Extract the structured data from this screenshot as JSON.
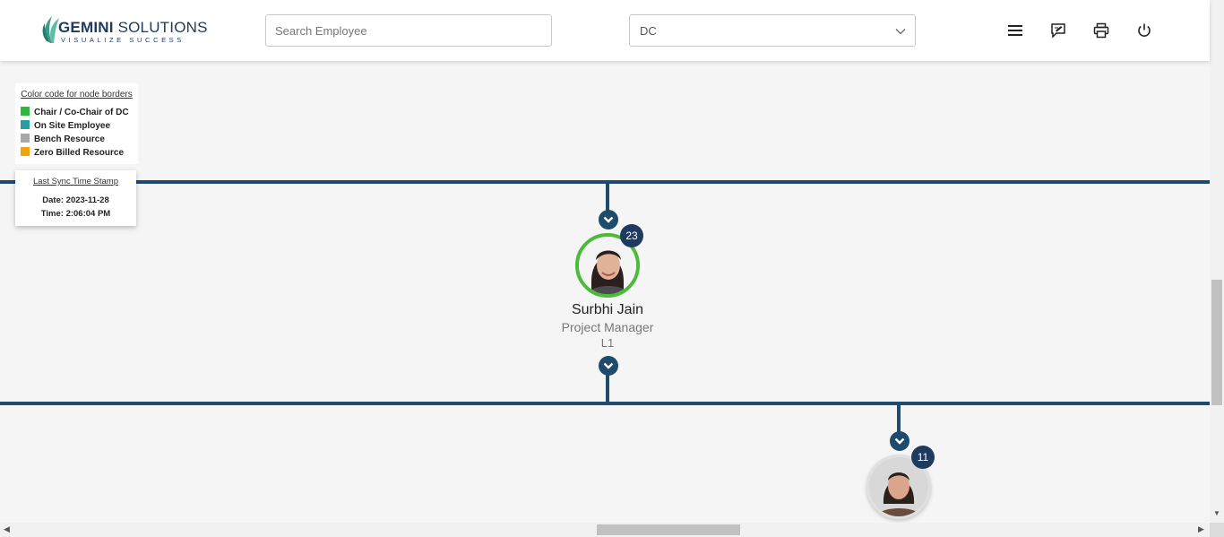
{
  "header": {
    "logo_name_bold": "GEMINI",
    "logo_name_light": "SOLUTIONS",
    "logo_tagline": "VISUALIZE SUCCESS",
    "search_placeholder": "Search Employee",
    "dc_select_value": "DC",
    "icons": [
      "menu-icon",
      "feedback-icon",
      "print-icon",
      "power-icon"
    ]
  },
  "legend": {
    "title": "Color code for node borders",
    "items": [
      {
        "label": "Chair / Co-Chair of DC",
        "color": "#2db83d"
      },
      {
        "label": "On Site Employee",
        "color": "#2a9da0"
      },
      {
        "label": "Bench Resource",
        "color": "#a9a9a9"
      },
      {
        "label": "Zero Billed Resource",
        "color": "#f0a30a"
      }
    ]
  },
  "sync": {
    "title": "Last Sync Time Stamp",
    "date": "Date: 2023-11-28",
    "time": "Time: 2:06:04 PM"
  },
  "nodes": [
    {
      "name": "Surbhi Jain",
      "role": "Project Manager",
      "level": "L1",
      "count": "23",
      "border_color": "#4cbb3a"
    },
    {
      "name": "",
      "role": "",
      "level": "",
      "count": "11",
      "border_color": "#c9c9c9"
    }
  ],
  "colors": {
    "tree_line": "#1e4a6b",
    "badge": "#1e3a5f",
    "brand": "#1e3a5f"
  }
}
